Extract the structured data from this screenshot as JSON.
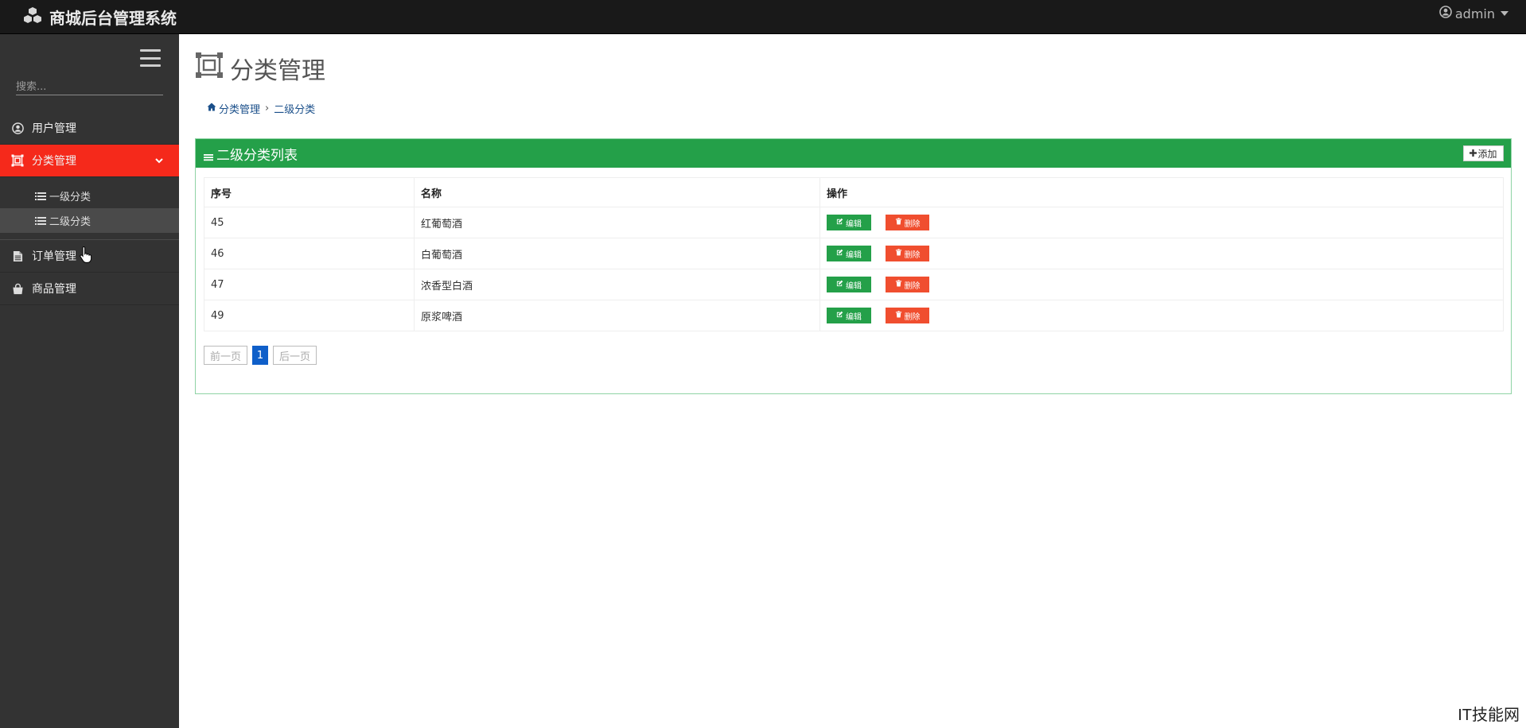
{
  "app": {
    "title": "商城后台管理系统",
    "user": "admin"
  },
  "sidebar": {
    "search_placeholder": "搜索...",
    "items": [
      {
        "label": "用户管理",
        "icon": "user-circle-icon"
      },
      {
        "label": "分类管理",
        "icon": "category-icon",
        "active": true,
        "children": [
          {
            "label": "一级分类",
            "icon": "list-icon"
          },
          {
            "label": "二级分类",
            "icon": "list-icon",
            "selected": true
          }
        ]
      },
      {
        "label": "订单管理",
        "icon": "document-icon"
      },
      {
        "label": "商品管理",
        "icon": "bag-icon"
      }
    ]
  },
  "page": {
    "title": "分类管理",
    "breadcrumb": {
      "home": "分类管理",
      "separator": "›",
      "current": "二级分类"
    }
  },
  "panel": {
    "title": "二级分类列表",
    "add_label": "添加",
    "columns": [
      "序号",
      "名称",
      "操作"
    ],
    "rows": [
      {
        "id": "45",
        "name": "红葡萄酒"
      },
      {
        "id": "46",
        "name": "白葡萄酒"
      },
      {
        "id": "47",
        "name": "浓香型白酒"
      },
      {
        "id": "49",
        "name": "原浆啤酒"
      }
    ],
    "edit_label": "编辑",
    "delete_label": "删除"
  },
  "pagination": {
    "prev": "前一页",
    "current": "1",
    "next": "后一页"
  },
  "watermark": "IT技能网",
  "colors": {
    "topbar": "#191919",
    "sidebar": "#333333",
    "active": "#f5291b",
    "panel_header": "#24a049",
    "delete": "#f04e2f",
    "page_current": "#0f5fc9"
  }
}
